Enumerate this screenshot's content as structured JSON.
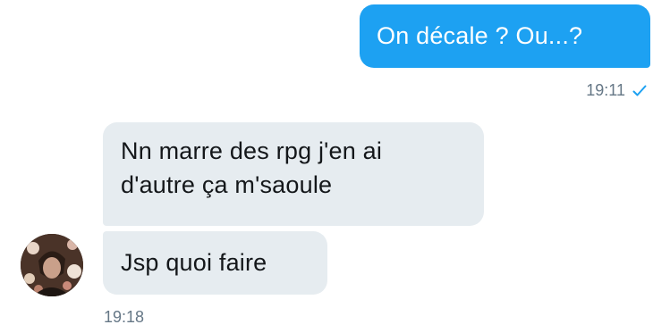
{
  "conversation": {
    "outgoing": {
      "text": "On décale ? Ou...?",
      "time": "19:11",
      "status_icon": "checkmark-icon",
      "bubble_color": "#1da1f2"
    },
    "incoming": {
      "messages": [
        {
          "lines": [
            "Nn marre des rpg j'en ai",
            "d'autre ça m'saoule"
          ]
        },
        {
          "lines": [
            "Jsp quoi faire"
          ]
        }
      ],
      "time": "19:18",
      "bubble_color": "#e6ecf0",
      "avatar_icon": "avatar"
    },
    "meta_color": "#657786"
  }
}
